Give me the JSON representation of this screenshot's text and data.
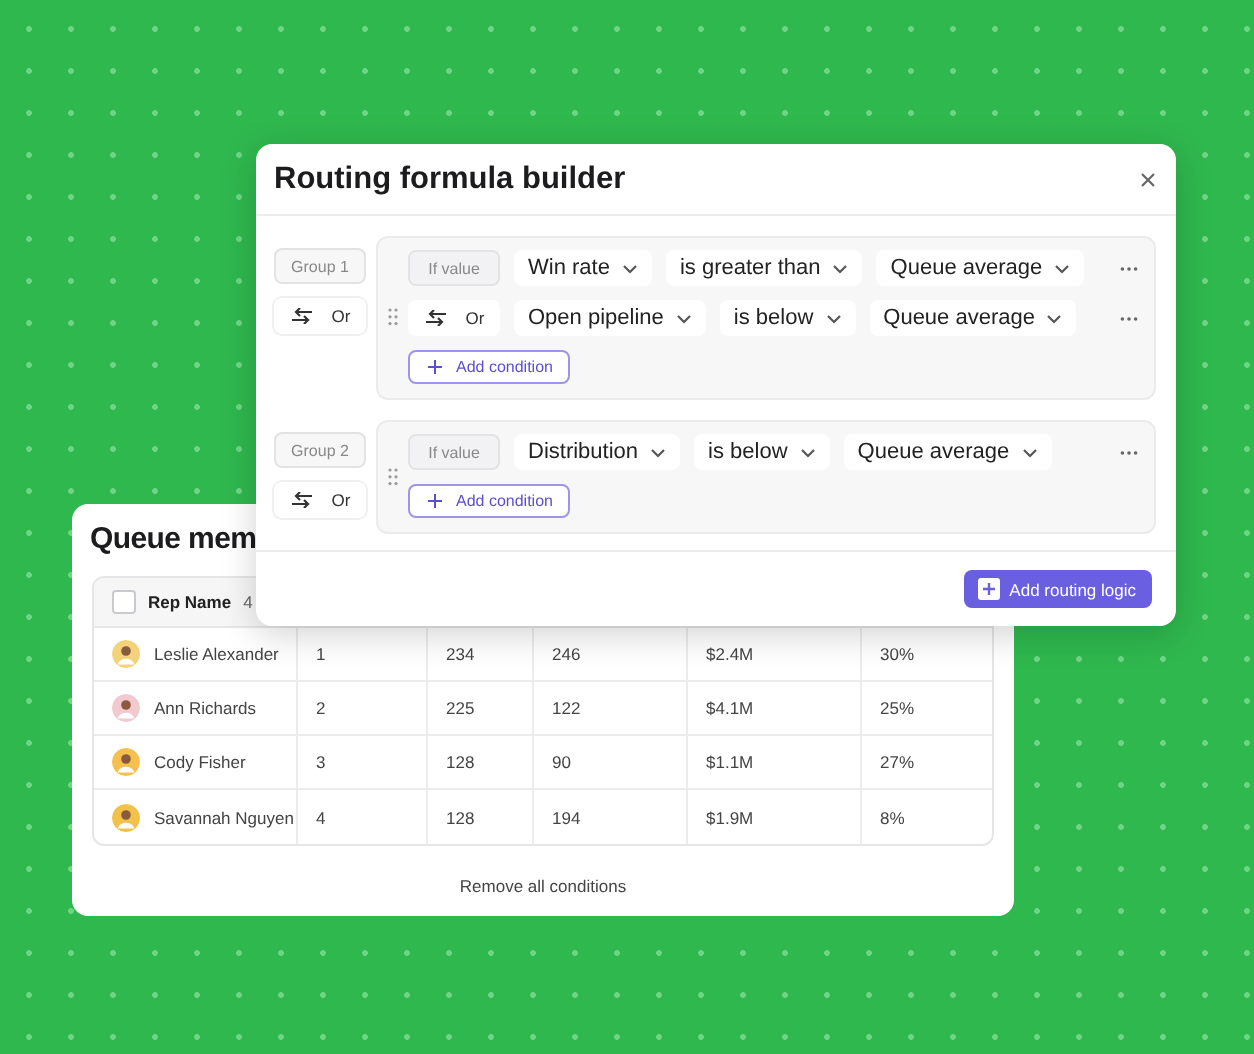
{
  "queue_members": {
    "title": "Queue mem",
    "table": {
      "header": {
        "checked": false,
        "label": "Rep Name",
        "count": "4"
      },
      "rows": [
        {
          "name": "Leslie Alexander",
          "cells": [
            "1",
            "234",
            "246",
            "$2.4M",
            "30%"
          ]
        },
        {
          "name": "Ann Richards",
          "cells": [
            "2",
            "225",
            "122",
            "$4.1M",
            "25%"
          ]
        },
        {
          "name": "Cody Fisher",
          "cells": [
            "3",
            "128",
            "90",
            "$1.1M",
            "27%"
          ]
        },
        {
          "name": "Savannah Nguyen",
          "cells": [
            "4",
            "128",
            "194",
            "$1.9M",
            "8%"
          ]
        }
      ]
    },
    "footer_link": "Remove all conditions"
  },
  "formula_builder": {
    "title": "Routing formula builder",
    "groups": [
      {
        "label": "Group 1",
        "connector": "Or",
        "conditions": [
          {
            "kind": "if",
            "prefix": "If value",
            "field": "Win rate",
            "operator": "is greater than",
            "value": "Queue average"
          },
          {
            "kind": "or",
            "prefix": "Or",
            "field": "Open pipeline",
            "operator": "is below",
            "value": "Queue average"
          }
        ],
        "add_button": "Add condition"
      },
      {
        "label": "Group 2",
        "connector": "Or",
        "conditions": [
          {
            "kind": "if",
            "prefix": "If value",
            "field": "Distribution",
            "operator": "is below",
            "value": "Queue average"
          }
        ],
        "add_button": "Add condition"
      }
    ],
    "primary_button": "Add routing logic"
  }
}
